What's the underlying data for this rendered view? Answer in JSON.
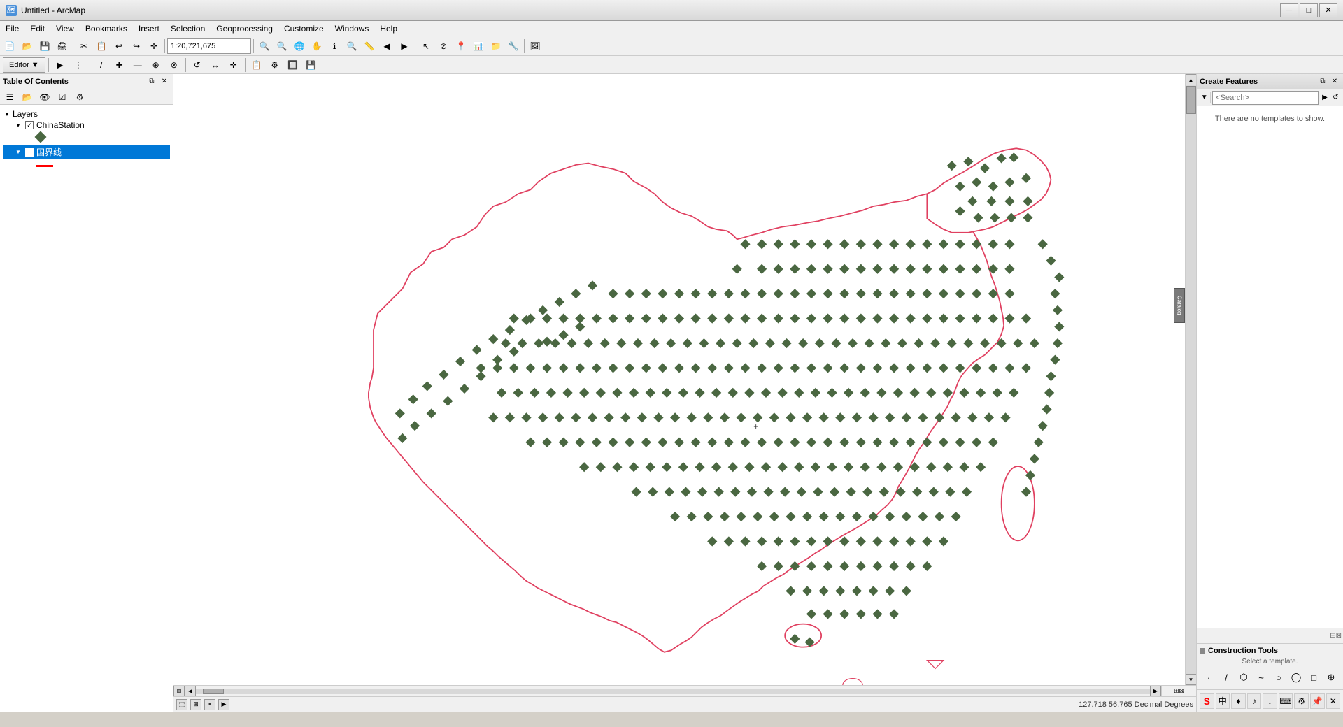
{
  "window": {
    "title": "Untitled - ArcMap",
    "icon": "🗺"
  },
  "titlebar": {
    "controls": [
      "─",
      "□",
      "✕"
    ]
  },
  "menu": {
    "items": [
      "File",
      "Edit",
      "View",
      "Bookmarks",
      "Insert",
      "Selection",
      "Geoprocessing",
      "Customize",
      "Windows",
      "Help"
    ]
  },
  "toolbar": {
    "scale": "1:20,721,675",
    "scale_placeholder": "1:20,721,675"
  },
  "editor_toolbar": {
    "editor_label": "Editor ▼",
    "tools": [
      "▶",
      "|",
      "⋮",
      "/",
      "✚",
      "—",
      "⊕",
      "⊗",
      "|",
      "⟨",
      "⟩",
      "|",
      "↔",
      "↕",
      "|",
      "✦",
      "⊞",
      "◫",
      "▭",
      "⬚",
      "∥",
      "⊡",
      "⌶",
      "|",
      "⬔",
      "⬕",
      "⬗",
      "⬖"
    ]
  },
  "toc": {
    "title": "Table Of Contents",
    "layers_label": "Layers",
    "layers": [
      {
        "name": "ChinaStation",
        "checked": true,
        "type": "point",
        "color": "#4a6741"
      },
      {
        "name": "国界线",
        "checked": true,
        "type": "line",
        "color": "red",
        "selected": true
      }
    ]
  },
  "create_features": {
    "title": "Create Features",
    "search_placeholder": "<Search>",
    "no_templates_text": "There are no templates to show.",
    "construction_title": "Construction Tools",
    "construction_sub": "Select a template.",
    "tools": [
      "S",
      "中",
      "♦",
      "♪",
      "↓",
      "⬛",
      "⬜",
      "▦",
      "⊕"
    ]
  },
  "status": {
    "coords": "127.718  56.765 Decimal Degrees",
    "panel_resize_hint": "⊡"
  },
  "map": {
    "background": "white",
    "border_color": "red",
    "point_color": "#4a6741"
  }
}
